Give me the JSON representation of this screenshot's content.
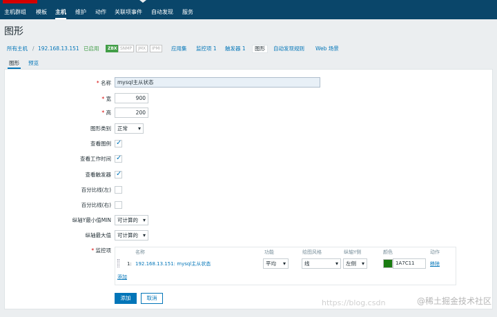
{
  "nav": {
    "items": [
      {
        "label": "主机群组"
      },
      {
        "label": "模板"
      },
      {
        "label": "主机",
        "active": true
      },
      {
        "label": "维护"
      },
      {
        "label": "动作"
      },
      {
        "label": "关联项事件"
      },
      {
        "label": "自动发现"
      },
      {
        "label": "服务"
      }
    ]
  },
  "page": {
    "title": "图形"
  },
  "breadcrumb": {
    "all_hosts": "所有主机",
    "sep": "/",
    "host": "192.168.13.151",
    "status": "已启用",
    "badges": [
      "ZBX",
      "SNMP",
      "JMX",
      "IPMI"
    ],
    "links": [
      "应用集",
      "监控项 1",
      "触发器 1",
      "图形",
      "自动发现规则",
      "Web 场景"
    ]
  },
  "tabs": [
    "图形",
    "预览"
  ],
  "form": {
    "required_mark": "*",
    "name_label": "名称",
    "name_value": "mysql主从状态",
    "width_label": "宽",
    "width_value": "900",
    "height_label": "高",
    "height_value": "200",
    "graph_type_label": "图形类别",
    "graph_type_value": "正常",
    "show_legend_label": "查看图例",
    "show_work_period_label": "查看工作时间",
    "show_triggers_label": "查看触发器",
    "percentile_left_label": "百分比线(左)",
    "percentile_right_label": "百分比线(右)",
    "ymin_label": "纵轴Y最小值MIN",
    "ymin_value": "可计算的",
    "ymax_label": "纵轴最大值",
    "ymax_value": "可计算的",
    "items_label": "监控项"
  },
  "items_table": {
    "headers": [
      "名称",
      "功能",
      "绘图风格",
      "纵轴Y侧",
      "颜色",
      "动作"
    ],
    "rows": [
      {
        "index": "1:",
        "name": "192.168.13.151: mysql主从状态",
        "function": "平均",
        "style": "线",
        "axis_side": "左侧",
        "color": "1A7C11",
        "action": "移除"
      }
    ],
    "add_label": "添加"
  },
  "buttons": {
    "add": "添加",
    "cancel": "取消"
  },
  "watermark": {
    "site": "https://blog.csdn",
    "text": "@稀土掘金技术社区"
  },
  "colors": {
    "nav_bg": "#0a466a",
    "link": "#0275b8",
    "item_color": "#1a7c11",
    "enabled": "#429e47"
  }
}
